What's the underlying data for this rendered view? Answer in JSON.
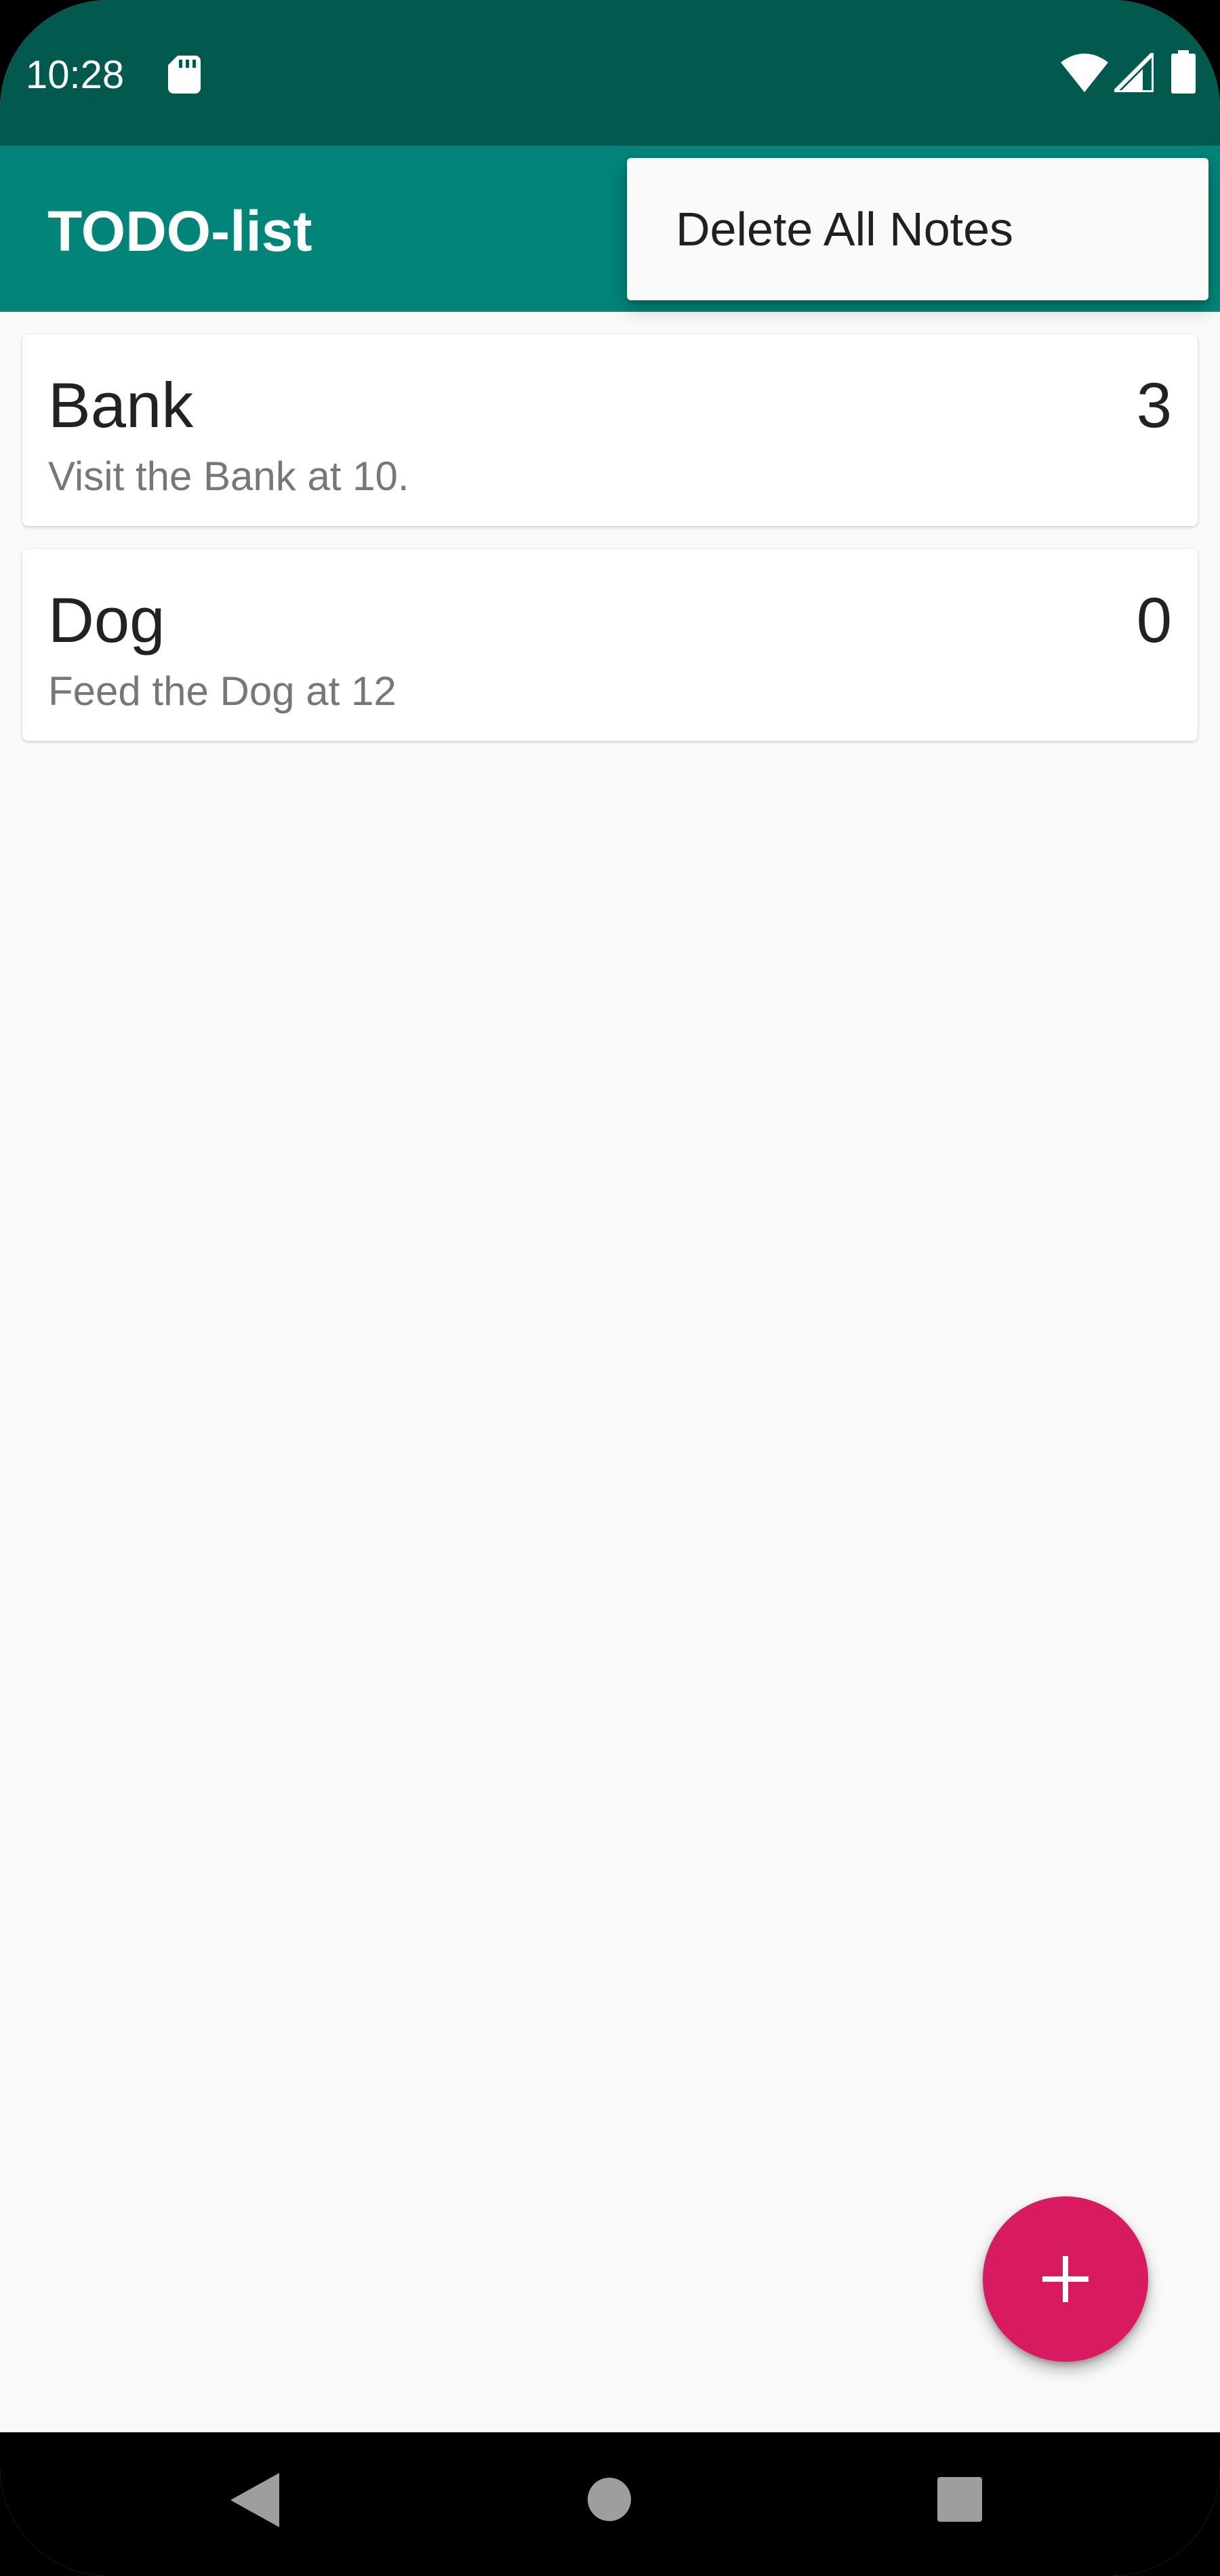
{
  "status_bar": {
    "time": "10:28",
    "icons": [
      "sd-card-icon",
      "wifi-icon",
      "signal-icon",
      "battery-icon"
    ]
  },
  "app_bar": {
    "title": "TODO-list",
    "color": "#028578"
  },
  "overflow_menu": {
    "items": [
      {
        "label": "Delete All Notes"
      }
    ]
  },
  "notes": [
    {
      "title": "Bank",
      "description": "Visit the Bank at 10.",
      "priority": "3"
    },
    {
      "title": "Dog",
      "description": "Feed the Dog at 12",
      "priority": "0"
    }
  ],
  "fab": {
    "icon": "plus-icon",
    "color": "#d81b60"
  },
  "navigation_bar": {
    "icons": [
      "back-icon",
      "home-icon",
      "recents-icon"
    ]
  },
  "colors": {
    "status_bar": "#02594d",
    "primary": "#028578",
    "accent": "#d81b60",
    "background": "#f9f9f9"
  }
}
